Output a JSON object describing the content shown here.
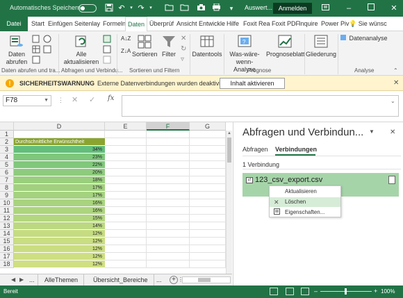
{
  "colors": {
    "brand": "#217346",
    "warning_bg": "#fff4ce",
    "connection_selected": "#a6d4a9"
  },
  "titlebar": {
    "autosave_label": "Automatisches Speichern",
    "autosave_state": "off",
    "icons": [
      "save-icon",
      "undo-icon",
      "redo-icon",
      "folder-icon",
      "folder-icon",
      "camera-icon",
      "print-icon",
      "more-icon"
    ],
    "document_title": "Auswert...",
    "signin_label": "Anmelden",
    "window_controls": [
      "restore-icon",
      "minimize-icon",
      "maximize-icon",
      "close-icon"
    ]
  },
  "ribbon_tabs": [
    "Datei",
    "Start",
    "Einfügen",
    "Seitenlay",
    "Formeln",
    "Daten",
    "Überprüf",
    "Ansicht",
    "Entwickle",
    "Hilfe",
    "Foxit Rea",
    "Foxit PDF",
    "Inquire",
    "Power Piv"
  ],
  "active_tab": "Daten",
  "help_label": "Sie wünsc",
  "ribbon": {
    "get_data_label": "Daten abrufen",
    "refresh_all_label": "Alle aktualisieren",
    "sort_label": "Sortieren",
    "filter_label": "Filter",
    "data_tools_label": "Datentools",
    "what_if_label": "Was-wäre-wenn-Analyse",
    "forecast_sheet_label": "Prognoseblatt",
    "outline_label": "Gliederung",
    "data_analysis_label": "Datenanalyse",
    "groups": [
      "Daten abrufen und tra...",
      "Abfragen und Verbindu...",
      "Sortieren und Filtern",
      "Prognose",
      "Analyse"
    ]
  },
  "warning": {
    "title": "SICHERHEITSWARNUNG",
    "text": "Externe Datenverbindungen wurden deaktiviert.",
    "button": "Inhalt aktivieren"
  },
  "formula_bar": {
    "name_box": "F78",
    "fx": "fx",
    "formula": ""
  },
  "grid": {
    "columns": [
      "D",
      "E",
      "F",
      "G"
    ],
    "selected_column": "F",
    "rows": [
      "1",
      "2",
      "3",
      "4",
      "5",
      "6",
      "7",
      "8",
      "9",
      "10",
      "11",
      "12",
      "13",
      "14",
      "15",
      "16",
      "17",
      "18"
    ],
    "header_cell": "Durchschnittliche Erwünschtheit",
    "values": [
      "34%",
      "23%",
      "22%",
      "20%",
      "18%",
      "17%",
      "17%",
      "16%",
      "16%",
      "15%",
      "14%",
      "12%",
      "12%",
      "12%",
      "12%",
      "12%"
    ],
    "value_colors": [
      "#63be7b",
      "#7ec77c",
      "#81c77c",
      "#8ecb7d",
      "#9acf7e",
      "#a1d17e",
      "#a4d27f",
      "#a9d37f",
      "#add47f",
      "#b3d680",
      "#bcd981",
      "#c6dc81",
      "#c9dd82",
      "#cbdd82",
      "#cddf82",
      "#d0df82"
    ]
  },
  "sheet_tabs": {
    "tabs": [
      "...",
      "AlleThemen",
      "Übersicht_Bereiche",
      "..."
    ]
  },
  "queries_pane": {
    "title": "Abfragen und Verbindun...",
    "tab_queries": "Abfragen",
    "tab_connections": "Verbindungen",
    "count_label": "1 Verbindung",
    "connection_name": "123_csv_export.csv"
  },
  "context_menu": {
    "items": [
      {
        "label": "Aktualisieren",
        "icon": ""
      },
      {
        "label": "Löschen",
        "icon": "x-icon"
      },
      {
        "label": "Eigenschaften...",
        "icon": "properties-icon"
      }
    ],
    "highlighted": "Löschen"
  },
  "status_bar": {
    "ready": "Bereit",
    "zoom": "100%",
    "zoom_minus": "–",
    "zoom_plus": "+"
  }
}
